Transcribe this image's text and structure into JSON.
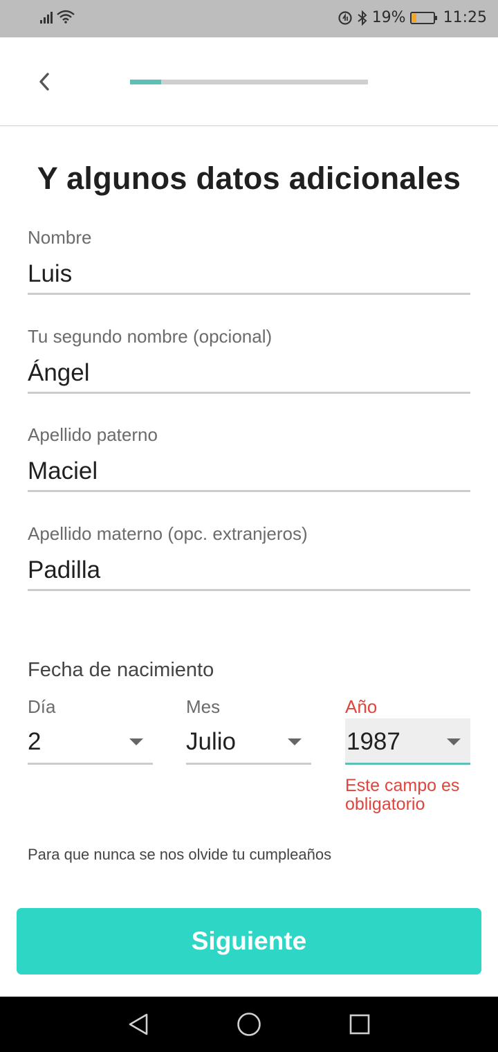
{
  "status_bar": {
    "battery_percent": "19%",
    "battery_level": 0.19,
    "time": "11:25",
    "icons": [
      "signal-icon",
      "wifi-icon",
      "data-saver-icon",
      "bluetooth-icon",
      "battery-icon"
    ]
  },
  "header": {
    "back_icon": "chevron-left-icon",
    "progress": 0.13,
    "progress_color": "#5cc0b6"
  },
  "title": "Y algunos datos adicionales",
  "fields": [
    {
      "label": "Nombre",
      "value": "Luis"
    },
    {
      "label": "Tu segundo nombre (opcional)",
      "value": "Ángel"
    },
    {
      "label": "Apellido paterno",
      "value": "Maciel"
    },
    {
      "label": "Apellido materno (opc. extranjeros)",
      "value": "Padilla"
    }
  ],
  "birthdate": {
    "label": "Fecha de nacimiento",
    "day": {
      "label": "Día",
      "value": "2"
    },
    "month": {
      "label": "Mes",
      "value": "Julio"
    },
    "year": {
      "label": "Año",
      "value": "1987"
    },
    "error": "Este campo es obligatorio",
    "helper": "Para que nunca se nos olvide tu cumpleaños"
  },
  "next_button": "Siguiente",
  "colors": {
    "accent": "#2ed6c5",
    "error": "#e0443a"
  },
  "nav_bar": {
    "icons": [
      "back-triangle-icon",
      "home-circle-icon",
      "recents-square-icon"
    ]
  }
}
